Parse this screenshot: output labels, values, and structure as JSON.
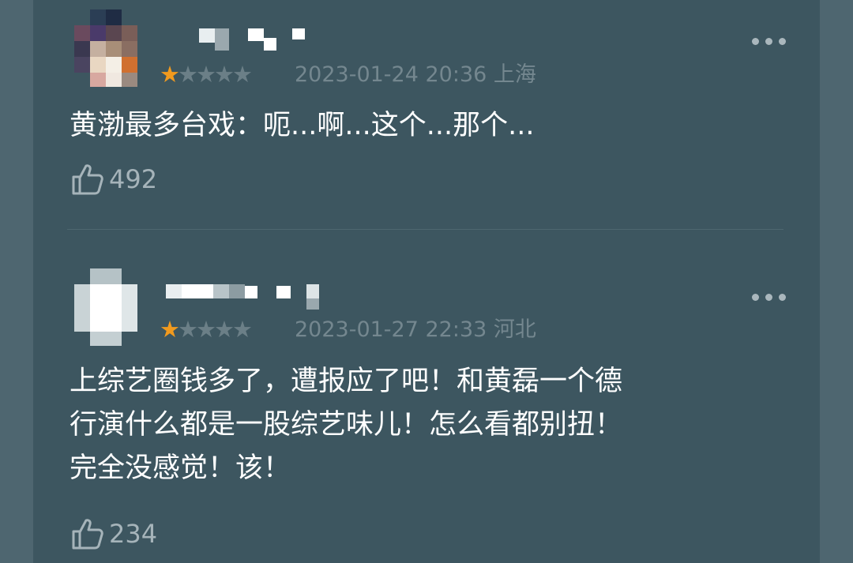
{
  "comments": [
    {
      "stars_filled": 1,
      "stars_total": 5,
      "date": "2023-01-24 20:36",
      "location": "上海",
      "text": "黄渤最多台戏：呃...啊...这个...那个...",
      "likes": "492",
      "icons": {
        "more": "more-dots-icon",
        "like": "thumbs-up-icon"
      }
    },
    {
      "stars_filled": 1,
      "stars_total": 5,
      "date": "2023-01-27 22:33",
      "location": "河北",
      "text": "上综艺圈钱多了，遭报应了吧！和黄磊一个德\n行演什么都是一股综艺味儿！怎么看都别扭！\n完全没感觉！该！",
      "likes": "234",
      "icons": {
        "more": "more-dots-icon",
        "like": "thumbs-up-icon"
      }
    }
  ],
  "colors": {
    "background": "#3d5660",
    "star_on": "#f19a1e",
    "star_off": "#6b7f87",
    "meta_text": "#74878f",
    "body_text": "#ffffff"
  }
}
